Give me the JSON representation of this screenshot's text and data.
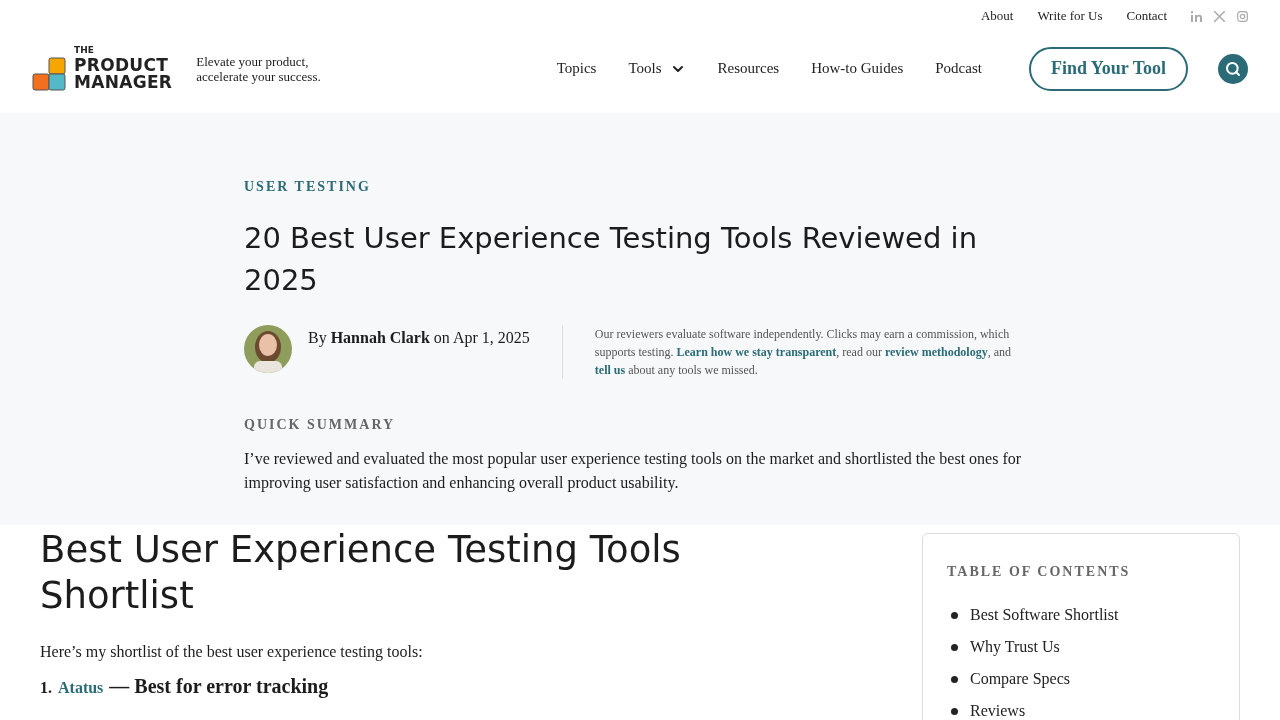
{
  "top_links": [
    "About",
    "Write for Us",
    "Contact"
  ],
  "social": [
    {
      "kind": "linkedin"
    },
    {
      "kind": "x"
    },
    {
      "kind": "instagram"
    }
  ],
  "logo": {
    "small": "THE",
    "line1": "PRODUCT",
    "line2": "MANAGER"
  },
  "tagline": [
    "Elevate your product,",
    "accelerate your success."
  ],
  "nav": [
    {
      "label": "Topics",
      "dropdown": false
    },
    {
      "label": "Tools",
      "dropdown": true
    },
    {
      "label": "Resources",
      "dropdown": false
    },
    {
      "label": "How-to Guides",
      "dropdown": false
    },
    {
      "label": "Podcast",
      "dropdown": false
    }
  ],
  "cta": "Find Your Tool",
  "hero": {
    "category": "USER TESTING",
    "title": "20 Best User Experience Testing Tools Reviewed in 2025",
    "byline": {
      "by": "By",
      "author": "Hannah Clark",
      "on": "on Apr 1, 2025"
    },
    "disclosure": [
      {
        "text": "Our reviewers evaluate software independently. Clicks may earn a commission, which supports testing. ",
        "link": false
      },
      {
        "text": "Learn how we stay transparent",
        "link": true
      },
      {
        "text": ", read our ",
        "link": false
      },
      {
        "text": "review methodology",
        "link": true
      },
      {
        "text": ", and ",
        "link": false
      },
      {
        "text": "tell us",
        "link": true
      },
      {
        "text": " about any tools we missed.",
        "link": false
      }
    ],
    "summary_label": "QUICK SUMMARY",
    "summary": "I’ve reviewed and evaluated the most popular user experience testing tools on the market and shortlisted the best ones for improving user satisfaction and enhancing overall product usability."
  },
  "article": {
    "heading": "Best User Experience Testing Tools Shortlist",
    "intro": "Here’s my shortlist of the best user experience testing tools:",
    "items": [
      {
        "number": "1.",
        "tool": "Atatus",
        "best_for": "— Best for error tracking"
      }
    ]
  },
  "toc": {
    "title": "TABLE OF CONTENTS",
    "items": [
      "Best Software Shortlist",
      "Why Trust Us",
      "Compare Specs",
      "Reviews"
    ]
  }
}
